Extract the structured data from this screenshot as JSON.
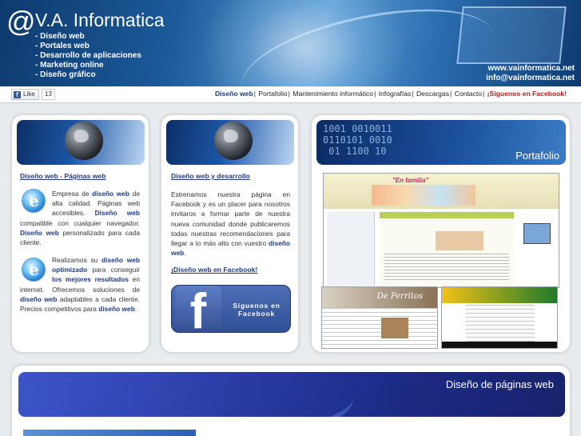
{
  "header": {
    "logo_at": "@",
    "logo_text": "V.A. Informatica",
    "services": [
      "- Diseño web",
      "- Portales web",
      "- Desarrollo de aplicaciones",
      "- Marketing online",
      "- Diseño gráfico"
    ],
    "website": "www.vainformatica.net",
    "email": "info@vainformatica.net"
  },
  "navbar": {
    "fb_like_label": "Like",
    "fb_like_icon": "f",
    "fb_like_count": "13",
    "links": [
      {
        "label": "Diseño web"
      },
      {
        "label": "Portafolio"
      },
      {
        "label": "Mantenimiento informático"
      },
      {
        "label": "Infografías"
      },
      {
        "label": "Descargas"
      },
      {
        "label": "Contacto"
      },
      {
        "label": "¡Síguenos en Facebook!"
      }
    ],
    "separator": "|"
  },
  "panel1": {
    "title": "Diseño web - Páginas web",
    "para1": {
      "t1": "Empresa de ",
      "b1": "diseño web",
      "t2": " de alta calidad. Páginas web accesibles. ",
      "b2": "Diseño web",
      "t3": " compatible con cualquier navegador. ",
      "b3": "Diseño web",
      "t4": " personalizado para cada cliente."
    },
    "para2": {
      "t1": "Realizamos su ",
      "b1": "diseño web optimizado",
      "t2": " para conseguir ",
      "b2": "los mejores resultados",
      "t3": " en internet. Ofrecemos soluciones de ",
      "b3": "diseño web",
      "t4": " adaptables a cada cliente. Precios competitivos para ",
      "b4": "diseño web",
      "t5": "."
    }
  },
  "panel2": {
    "title": "Diseño web y desarrollo",
    "para": {
      "t1": "Estrenamos nuestra página en Facebook y es un placer para nosotros invitaros a formar parte de nuestra nueva comunidad donde publicaremos todas nuestras recomendaciones para llegar a lo más alto con vuestro ",
      "b1": "diseño web",
      "t2": "."
    },
    "link": "¡Diseño web en Facebook!",
    "fb_banner_letter": "f",
    "fb_banner_text": "Síguenos en Facebook"
  },
  "panel3": {
    "banner_label": "Portafolio",
    "banner_bits": "1001 0010011\n0110101 0010\n 01 1100 10",
    "shot1_brand": "\"En familia\"",
    "shot2_title": "De Perritos"
  },
  "bottom": {
    "banner_label": "Diseño de páginas web"
  }
}
